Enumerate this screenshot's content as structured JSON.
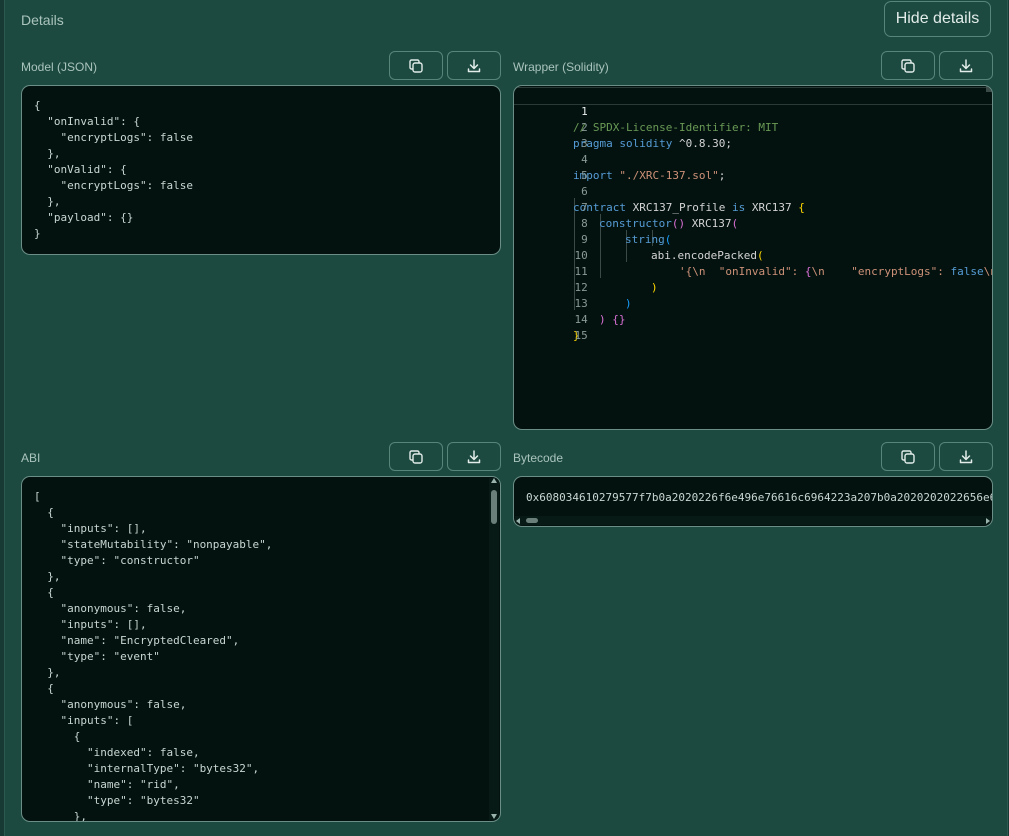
{
  "header": {
    "title": "Details",
    "hide_label": "Hide details"
  },
  "sections": {
    "model_label": "Model (JSON)",
    "wrapper_label": "Wrapper (Solidity)",
    "abi_label": "ABI",
    "bytecode_label": "Bytecode"
  },
  "model_json": "{\n  \"onInvalid\": {\n    \"encryptLogs\": false\n  },\n  \"onValid\": {\n    \"encryptLogs\": false\n  },\n  \"payload\": {}\n}",
  "wrapper": {
    "line_numbers": [
      "1",
      "2",
      "3",
      "4",
      "5",
      "6",
      "7",
      "8",
      "9",
      "10",
      "11",
      "12",
      "13",
      "14",
      "15"
    ],
    "active_line": "1",
    "l1": "// SPDX-License-Identifier: MIT",
    "l2_kw": "pragma solidity",
    "l2_rest": " ^0.8.30;",
    "l4_kw": "import",
    "l4_str": "\"./XRC-137.sol\"",
    "l4_end": ";",
    "l6_kw": "contract",
    "l6_name": " XRC137_Profile ",
    "l6_is": "is",
    "l6_base": " XRC137 ",
    "l6_brace": "{",
    "l7_kw": "constructor",
    "l7_paren": "()",
    "l7_call": " XRC137",
    "l7_open": "(",
    "l8_kw": "string",
    "l8_open": "(",
    "l9_call": "abi.encodePacked",
    "l9_open": "(",
    "l10_str1": "'{\\n  \"onInvalid\": ",
    "l10_brace": "{",
    "l10_str2": "\\n    \"encryptLogs\": ",
    "l10_false": "false",
    "l10_tail": "\\n",
    "l11_close": ")",
    "l12_close": ")",
    "l13_close": ")",
    "l13_brace": " {}",
    "l14_close": "}"
  },
  "abi_json": "[\n  {\n    \"inputs\": [],\n    \"stateMutability\": \"nonpayable\",\n    \"type\": \"constructor\"\n  },\n  {\n    \"anonymous\": false,\n    \"inputs\": [],\n    \"name\": \"EncryptedCleared\",\n    \"type\": \"event\"\n  },\n  {\n    \"anonymous\": false,\n    \"inputs\": [\n      {\n        \"indexed\": false,\n        \"internalType\": \"bytes32\",\n        \"name\": \"rid\",\n        \"type\": \"bytes32\"\n      },",
  "bytecode": "0x608034610279577f7b0a2020226f6e496e76616c6964223a207b0a2020202022656e6",
  "icons": {
    "copy": "copy-icon",
    "download": "download-icon"
  }
}
